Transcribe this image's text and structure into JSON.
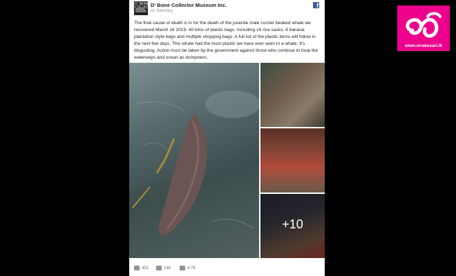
{
  "post": {
    "page_name": "D' Bone Collector Museum Inc.",
    "timestamp": "on Saturday",
    "avatar_text": "D' BONE COLLECTOR",
    "text": "The final cause of death is in for the death of the juvenile male curvier beaked whale we recovered March 16 2019. 40 kilos of plastic bags. Including 16 rice sacks. 4 banana plantation style bags and multiple shopping bags. A full list of the plastic items will follow in the next few days. This whale had the most plastic we have ever seen in a whale. It's disgusting. Action must be taken by the government against those who continue to treat the waterways and ocean as dumpsters.",
    "more_photos": "+10",
    "reactions": {
      "likes": "451",
      "comments": "148",
      "shares": "4.7K"
    }
  },
  "facebook_icon": "f",
  "watermark": {
    "url": "www.virakesari.lk",
    "glyph": "வீ",
    "color": "#ec008c"
  },
  "icons": [
    "facebook-icon",
    "like-icon",
    "comment-icon",
    "share-icon"
  ]
}
